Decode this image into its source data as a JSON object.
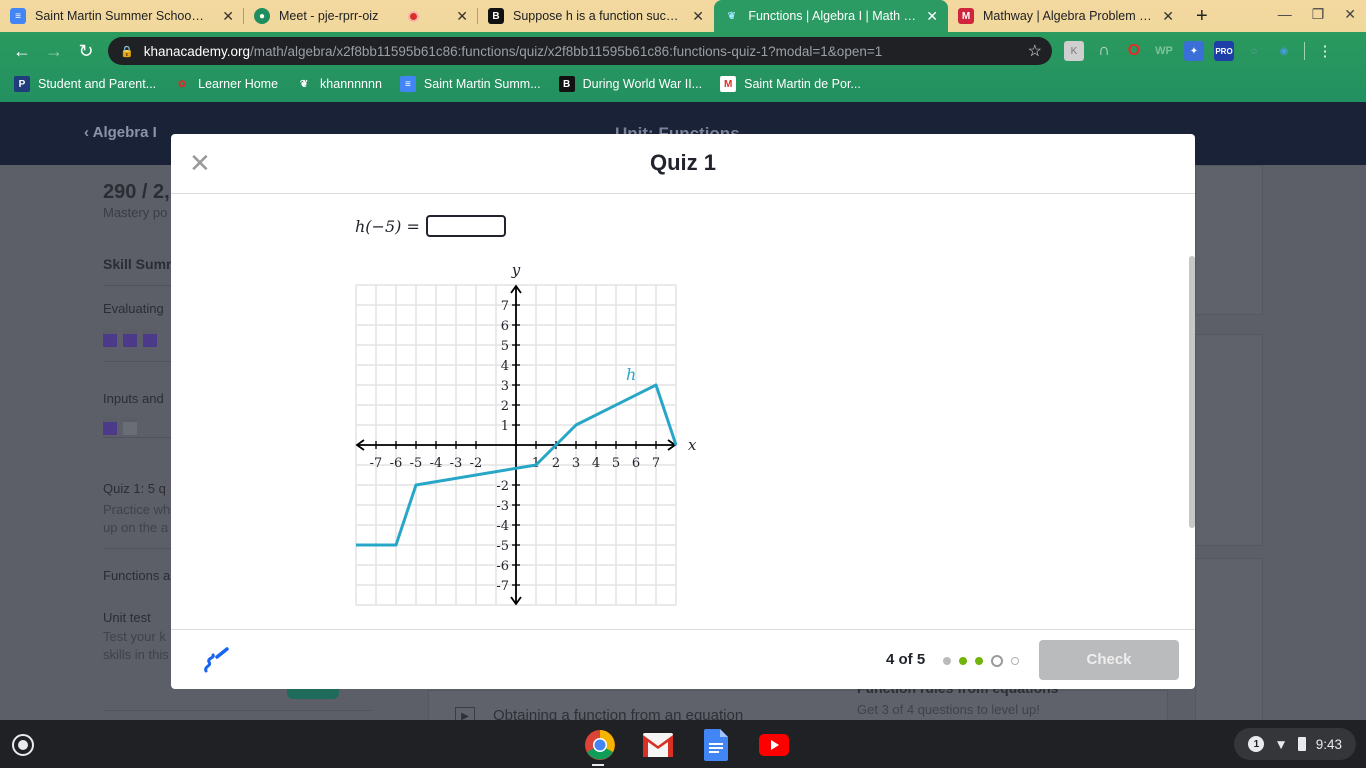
{
  "browser": {
    "tabs": [
      {
        "title": "Saint Martin Summer School Or",
        "icon": "google-docs-icon",
        "active": false
      },
      {
        "title": "Meet - pje-rprr-oiz",
        "icon": "google-meet-icon",
        "active": false,
        "recording": true
      },
      {
        "title": "Suppose h is a function such th",
        "icon": "brainly-icon",
        "active": false
      },
      {
        "title": "Functions | Algebra I | Math | Kh",
        "icon": "khan-academy-icon",
        "active": true
      },
      {
        "title": "Mathway | Algebra Problem Sol",
        "icon": "mathway-icon",
        "active": false
      }
    ],
    "new_tab_label": "+",
    "url_host": "khanacademy.org",
    "url_path": "/math/algebra/x2f8bb11595b61c86:functions/quiz/x2f8bb11595b61c86:functions-quiz-1?modal=1&open=1",
    "extensions": [
      "kami-icon",
      "nord-icon",
      "opera-icon",
      "wp-icon",
      "game-icon",
      "pro-icon",
      "screencast-icon",
      "circle-icon"
    ],
    "bookmarks": [
      {
        "label": "Student and Parent...",
        "icon": "powerschool-icon"
      },
      {
        "label": "Learner Home",
        "icon": "learner-icon"
      },
      {
        "label": "khannnnnn",
        "icon": "khan-academy-icon"
      },
      {
        "label": "Saint Martin Summ...",
        "icon": "google-docs-icon"
      },
      {
        "label": "During World War II...",
        "icon": "brainly-icon"
      },
      {
        "label": "Saint Martin de Por...",
        "icon": "gmail-icon"
      }
    ]
  },
  "background_page": {
    "back_link": "Algebra I",
    "unit_title": "Unit: Functions",
    "mastery_score": "290 / 2,",
    "mastery_label": "Mastery po",
    "skill_summary": "Skill Summ",
    "items": [
      {
        "title": "Evaluating",
        "bars": [
          "done",
          "done",
          "done"
        ]
      },
      {
        "title": "Inputs and",
        "bars": [
          "done",
          "todo"
        ]
      }
    ],
    "quiz_item_title": "Quiz 1: 5 q",
    "quiz_item_desc_1": "Practice wh",
    "quiz_item_desc_2": "up on the a",
    "functions_item": "Functions a",
    "unit_test_title": "Unit test",
    "unit_test_desc_1": "Test your k",
    "unit_test_desc_2": "skills in this",
    "video_link": "Obtaining a function from an equation",
    "skill_card_title": "Function rules from equations",
    "skill_card_desc": "Get 3 of 4 questions to level up!"
  },
  "modal": {
    "title": "Quiz 1",
    "question_lhs": "h(−5) =",
    "answer_value": "",
    "answer_placeholder": "",
    "progress_text": "4 of 5",
    "progress_dots": [
      "attempted",
      "correct",
      "correct",
      "current",
      "todo"
    ],
    "check_label": "Check",
    "colors": {
      "function_line": "#28a6c8",
      "correct": "#71b307",
      "check_disabled": "#babbbd"
    }
  },
  "chart_data": {
    "type": "line",
    "title": "",
    "xlabel": "x",
    "ylabel": "y",
    "xlim": [
      -8,
      8
    ],
    "ylim": [
      -8,
      8
    ],
    "grid": true,
    "x_ticks": [
      -7,
      -6,
      -5,
      -4,
      -3,
      -2,
      1,
      2,
      3,
      4,
      5,
      6,
      7
    ],
    "y_ticks": [
      -7,
      -6,
      -5,
      -4,
      -3,
      -2,
      1,
      2,
      3,
      4,
      5,
      6,
      7
    ],
    "series": [
      {
        "name": "h",
        "points": [
          [
            -8,
            -5
          ],
          [
            -6,
            -5
          ],
          [
            -5,
            -2
          ],
          [
            1,
            -1
          ],
          [
            3,
            1
          ],
          [
            7,
            3
          ],
          [
            8,
            0
          ]
        ]
      }
    ],
    "annotations": [
      {
        "text": "h",
        "x": 5.5,
        "y": 3.5
      }
    ]
  },
  "shelf": {
    "apps": [
      "chrome-icon",
      "gmail-icon",
      "google-docs-icon",
      "youtube-icon"
    ],
    "notification_count": "1",
    "time": "9:43"
  }
}
